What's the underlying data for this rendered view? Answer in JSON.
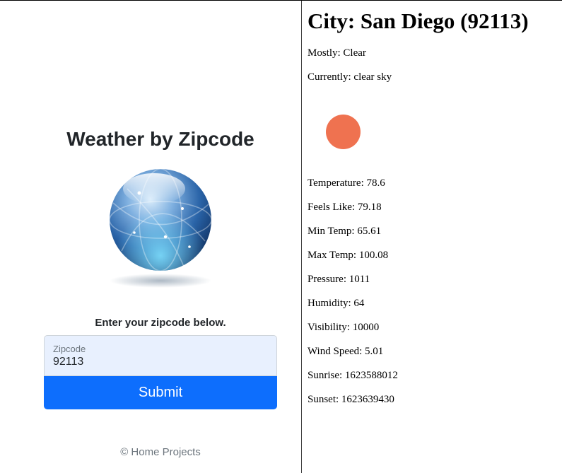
{
  "app": {
    "title": "Weather by Zipcode",
    "prompt": "Enter your zipcode below.",
    "zip_label": "Zipcode",
    "zip_value": "92113",
    "submit_label": "Submit",
    "footer": "© Home Projects"
  },
  "weather": {
    "city_heading": "City: San Diego (92113)",
    "mostly": "Mostly: Clear",
    "currently": "Currently: clear sky",
    "icon": "sun-icon",
    "icon_color": "#ef7250",
    "details": [
      "Temperature: 78.6",
      "Feels Like: 79.18",
      "Min Temp: 65.61",
      "Max Temp: 100.08",
      "Pressure: 1011",
      "Humidity: 64",
      "Visibility: 10000",
      "Wind Speed: 5.01",
      "Sunrise: 1623588012",
      "Sunset: 1623639430"
    ]
  },
  "colors": {
    "button_primary": "#0d6efd",
    "input_background": "#e8f0fe"
  }
}
